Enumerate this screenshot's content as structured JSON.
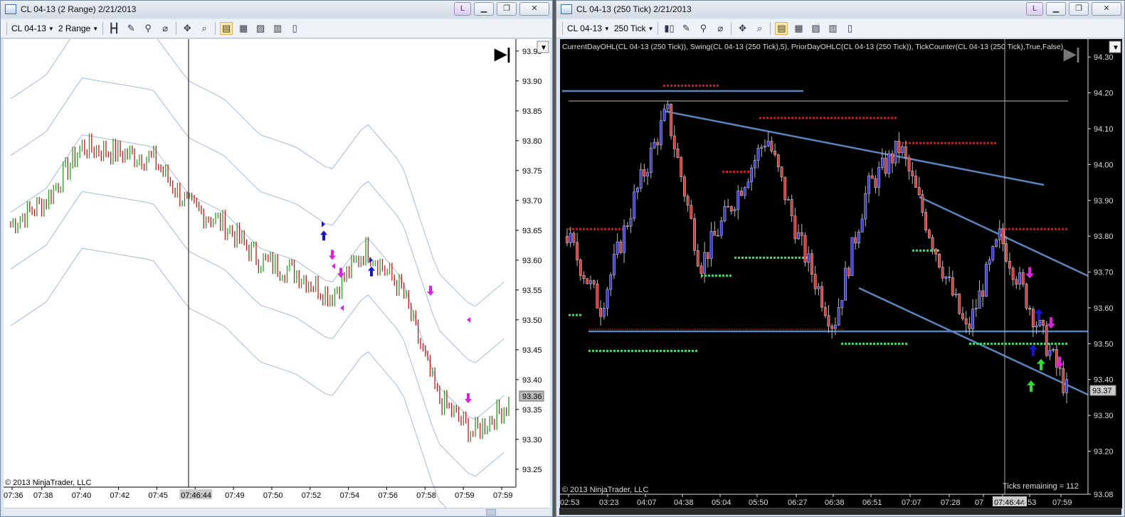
{
  "left": {
    "title": "CL 04-13 (2 Range)  2/21/2013",
    "instrument": "CL 04-13",
    "period": "2 Range",
    "link_label": "L",
    "price_labels": [
      "93.95",
      "93.90",
      "93.85",
      "93.80",
      "93.75",
      "93.70",
      "93.65",
      "93.60",
      "93.55",
      "93.50",
      "93.45",
      "93.40",
      "93.35",
      "93.30",
      "93.25"
    ],
    "time_labels": [
      "07:36",
      "07:38",
      "07:40",
      "07:42",
      "07:45",
      "07:46:44",
      "07:49",
      "07:50",
      "07:52",
      "07:54",
      "07:56",
      "07:58",
      "07:59",
      "07:59"
    ],
    "last_price": "93.36",
    "copyright": "© 2013 NinjaTrader, LLC"
  },
  "right": {
    "title": "CL 04-13 (250 Tick)  2/21/2013",
    "instrument": "CL 04-13",
    "period": "250 Tick",
    "link_label": "L",
    "indicator_text": "CurrentDayOHL(CL 04-13 (250 Tick)), Swing(CL 04-13 (250 Tick),5), PriorDayOHLC(CL 04-13 (250 Tick)), TickCounter(CL 04-13 (250 Tick),True,False)",
    "price_labels": [
      "94.30",
      "94.20",
      "94.10",
      "94.00",
      "93.90",
      "93.80",
      "93.70",
      "93.60",
      "93.50",
      "93.40",
      "93.30",
      "93.20",
      "93.08"
    ],
    "time_labels": [
      "02:53",
      "03:23",
      "04:07",
      "04:38",
      "05:04",
      "05:50",
      "06:27",
      "06:38",
      "06:51",
      "07:07",
      "07:28",
      "07",
      "07:46:44",
      "7:53",
      "07:59"
    ],
    "last_price": "93.37",
    "ticks_remaining": "Ticks remaining = 112",
    "copyright": "© 2013 NinjaTrader, LLC"
  },
  "chart_data": [
    {
      "type": "bar",
      "title": "CL 04-13 (2 Range)  2/21/2013",
      "ylim": [
        93.22,
        93.97
      ],
      "x": [
        "07:36",
        "07:38",
        "07:40",
        "07:42",
        "07:45",
        "07:46:44",
        "07:49",
        "07:50",
        "07:52",
        "07:54",
        "07:56",
        "07:58",
        "07:59",
        "07:59"
      ],
      "close": [
        93.66,
        93.7,
        93.79,
        93.78,
        93.77,
        93.69,
        93.66,
        93.6,
        93.58,
        93.54,
        93.62,
        93.55,
        93.37,
        93.31,
        93.36
      ],
      "last": 93.36
    },
    {
      "type": "bar",
      "title": "CL 04-13 (250 Tick)  2/21/2013",
      "ylim": [
        93.08,
        94.35
      ],
      "x": [
        "02:53",
        "03:23",
        "04:07",
        "04:38",
        "05:04",
        "05:50",
        "06:27",
        "06:38",
        "06:51",
        "07:07",
        "07:28",
        "07:46:44",
        "7:53",
        "07:59"
      ],
      "close": [
        93.8,
        93.6,
        93.9,
        94.15,
        93.72,
        93.9,
        94.08,
        93.78,
        93.55,
        93.93,
        94.05,
        93.78,
        93.53,
        93.8,
        93.58,
        93.37
      ],
      "last": 93.37
    }
  ]
}
